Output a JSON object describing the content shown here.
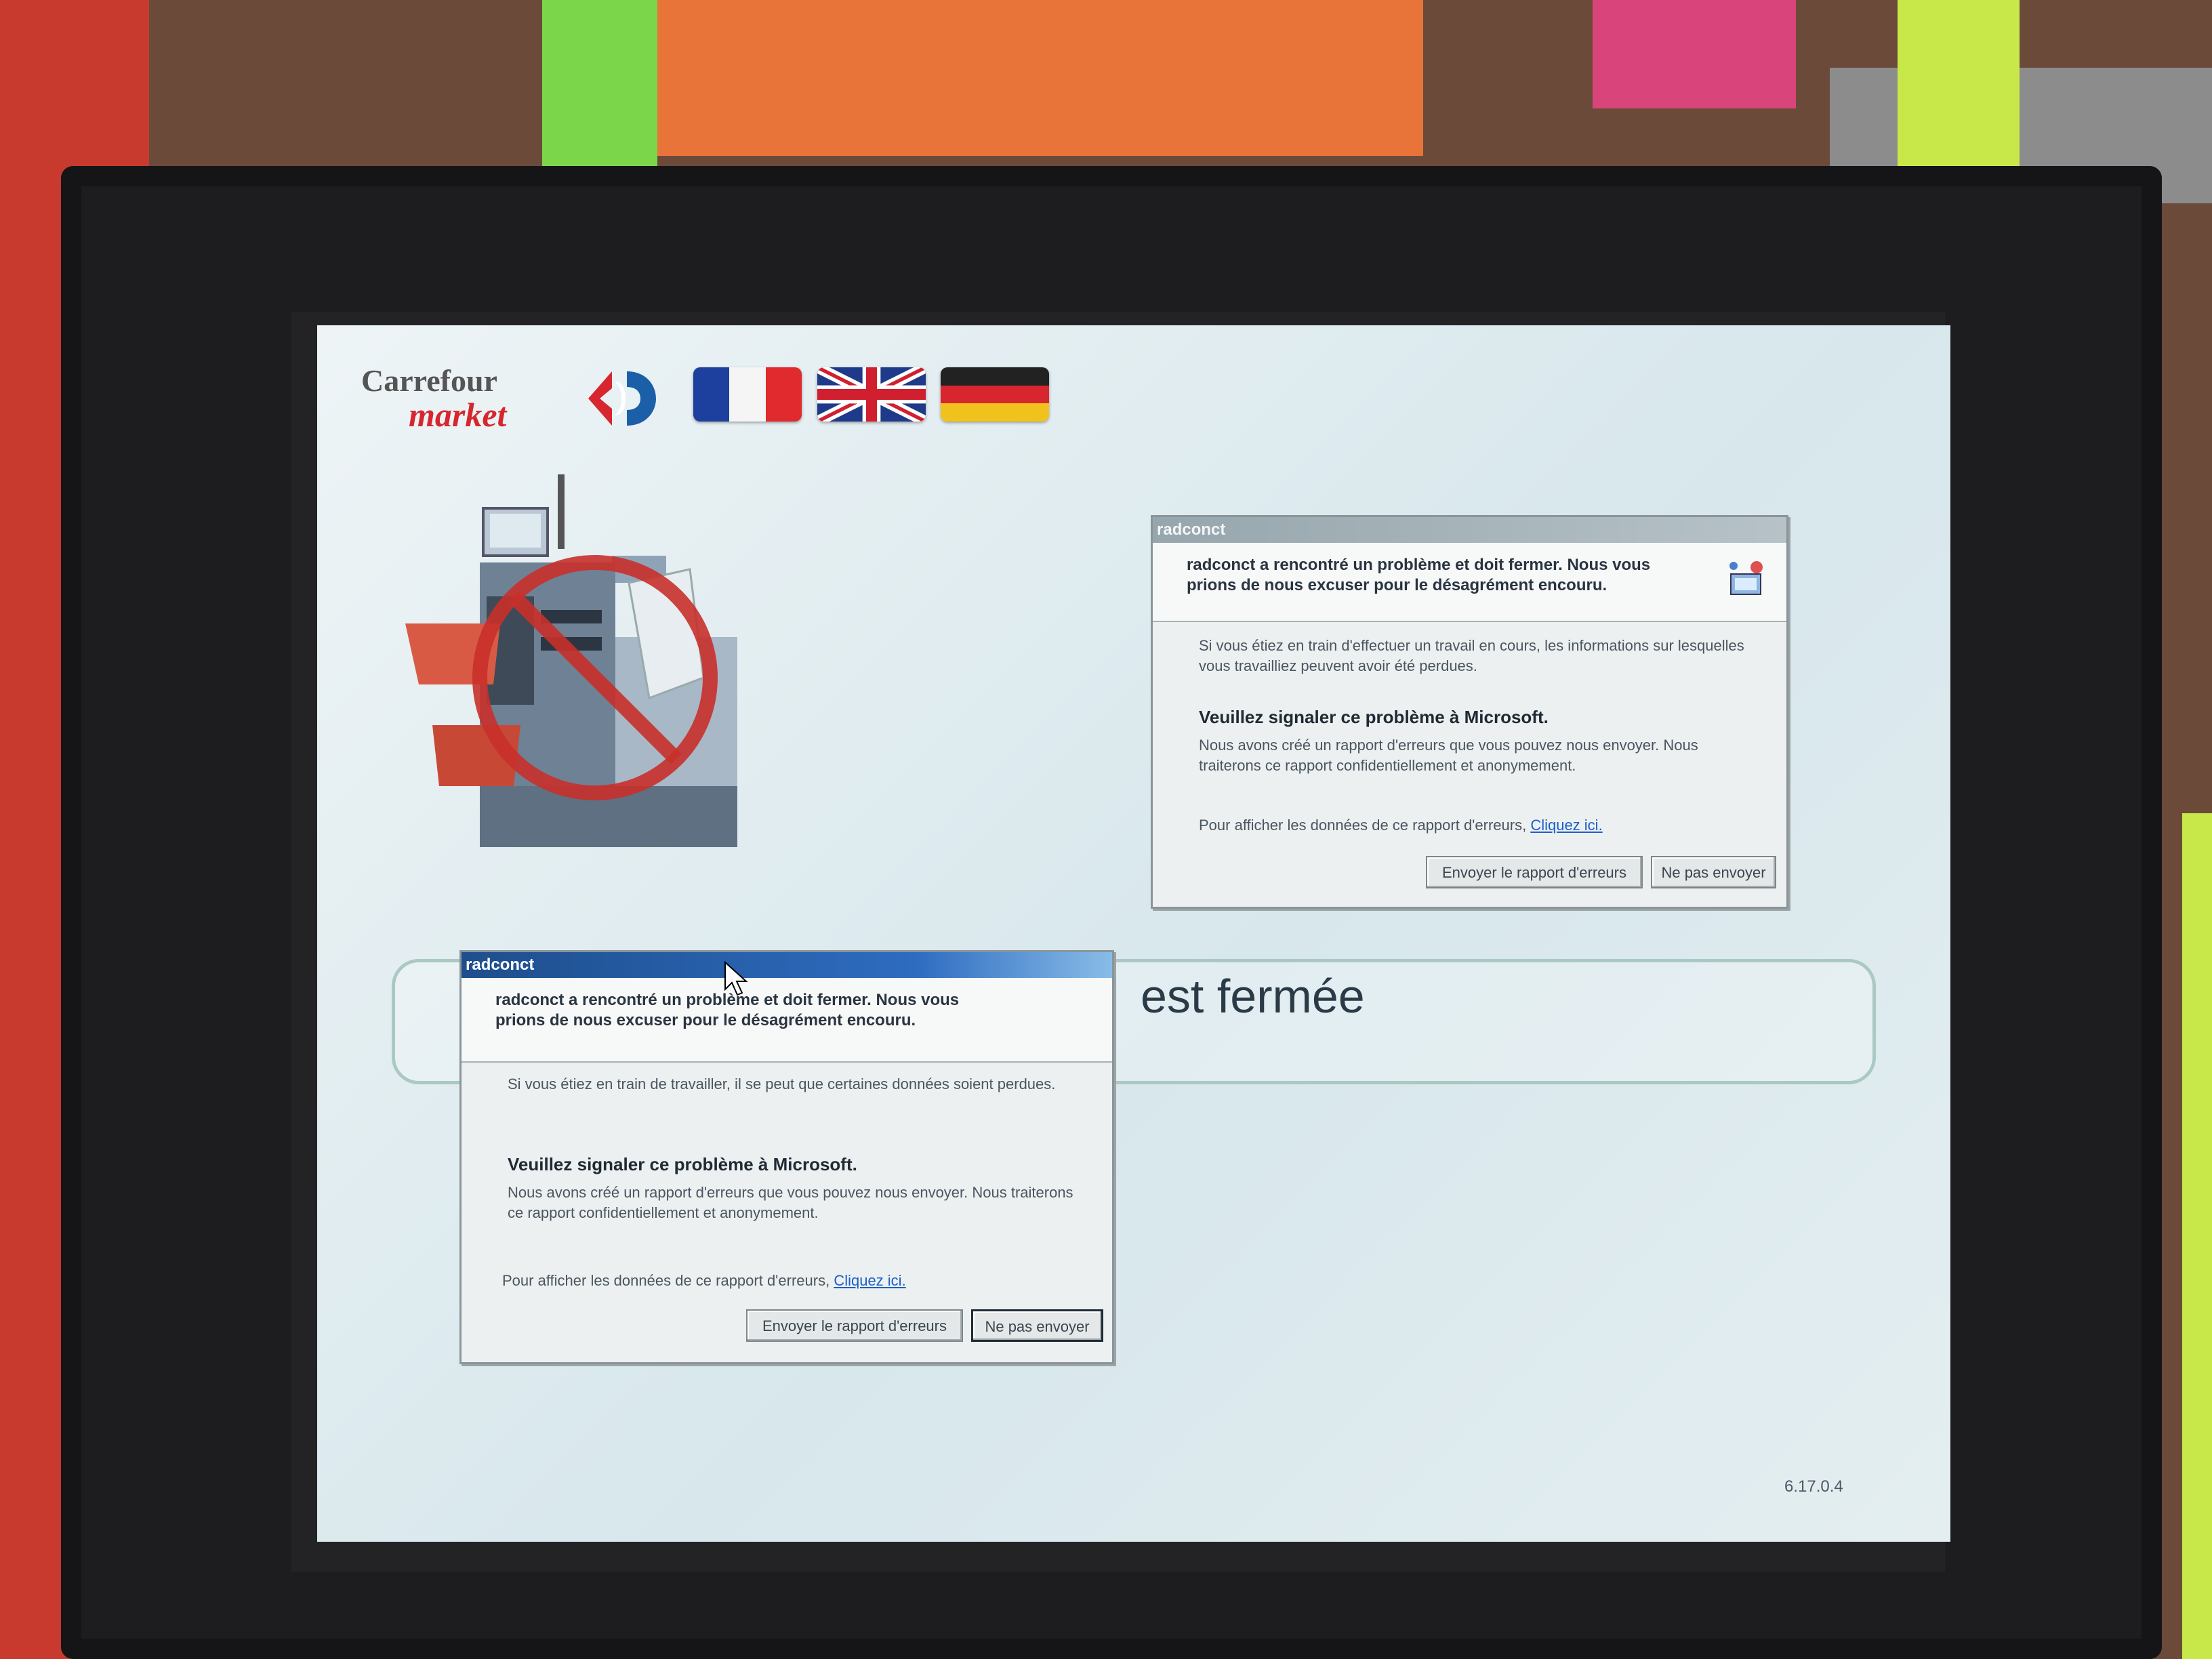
{
  "brand": {
    "line1": "Carrefour",
    "line2": "market",
    "red": "#d8262e",
    "blue": "#1b5fa8"
  },
  "languages": [
    "fr-flag-icon",
    "uk-flag-icon",
    "de-flag-icon"
  ],
  "status": {
    "text": "est fermée"
  },
  "version": "6.17.0.4",
  "dialogs": [
    {
      "title": "radconct",
      "heading": "radconct a rencontré un problème et doit fermer. Nous vous prions de nous excuser pour le désagrément encouru.",
      "info": "Si vous étiez en train d'effectuer un travail en cours, les informations sur lesquelles vous travailliez peuvent avoir été perdues.",
      "report_title": "Veuillez signaler ce problème à Microsoft.",
      "report_text": "Nous avons créé un rapport d'erreurs que vous pouvez nous envoyer. Nous traiterons ce rapport confidentiellement et anonymement.",
      "link_prefix": "Pour afficher les données de ce rapport d'erreurs,",
      "link_label": "Cliquez ici.",
      "send_label": "Envoyer le rapport d'erreurs",
      "dont_send_label": "Ne pas envoyer"
    },
    {
      "title": "radconct",
      "heading": "radconct a rencontré un problème et doit fermer. Nous vous prions de nous excuser pour le désagrément encouru.",
      "info": "Si vous étiez en train de travailler, il se peut que certaines données soient perdues.",
      "report_title": "Veuillez signaler ce problème à Microsoft.",
      "report_text": "Nous avons créé un rapport d'erreurs que vous pouvez nous envoyer. Nous traiterons ce rapport confidentiellement et anonymement.",
      "link_prefix": "Pour afficher les données de ce rapport d'erreurs,",
      "link_label": "Cliquez ici.",
      "send_label": "Envoyer le rapport d'erreurs",
      "dont_send_label": "Ne pas envoyer"
    }
  ]
}
